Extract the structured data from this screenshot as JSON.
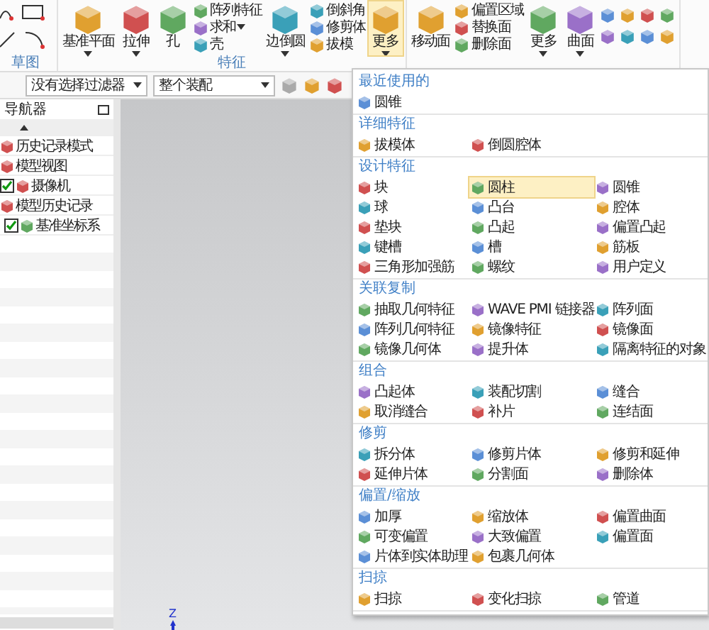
{
  "ribbon": {
    "sketch_group": {
      "label": "草图"
    },
    "feature_group": {
      "label": "特征",
      "tools": [
        {
          "kind": "large",
          "label": "基准平面",
          "dropdown": true,
          "selected": false
        },
        {
          "kind": "large",
          "label": "拉伸",
          "dropdown": true,
          "selected": false
        },
        {
          "kind": "large",
          "label": "孔",
          "dropdown": false,
          "selected": false
        },
        {
          "kind": "stack",
          "items": [
            {
              "label": "阵列特征",
              "dropdown": false
            },
            {
              "label": "求和",
              "dropdown": true
            },
            {
              "label": "壳",
              "dropdown": false
            }
          ]
        },
        {
          "kind": "large",
          "label": "边倒圆",
          "dropdown": true,
          "selected": false
        },
        {
          "kind": "stack",
          "items": [
            {
              "label": "倒斜角",
              "dropdown": false
            },
            {
              "label": "修剪体",
              "dropdown": false
            },
            {
              "label": "拔模",
              "dropdown": false
            }
          ]
        },
        {
          "kind": "large",
          "label": "更多",
          "dropdown": true,
          "selected": true
        }
      ]
    },
    "face_group": {
      "tools": [
        {
          "kind": "large",
          "label": "移动面",
          "dropdown": false,
          "selected": false
        },
        {
          "kind": "stack",
          "items": [
            {
              "label": "偏置区域",
              "dropdown": false
            },
            {
              "label": "替换面",
              "dropdown": false
            },
            {
              "label": "删除面",
              "dropdown": false
            }
          ]
        },
        {
          "kind": "large",
          "label": "更多",
          "dropdown": true,
          "selected": false
        },
        {
          "kind": "large",
          "label": "曲面",
          "dropdown": true,
          "selected": false
        }
      ]
    }
  },
  "toolbar": {
    "filter": "没有选择过滤器",
    "scope": "整个装配"
  },
  "navigator": {
    "title": "导航器",
    "tree": [
      {
        "label": "历史记录模式",
        "kind": "plain"
      },
      {
        "label": "模型视图",
        "kind": "plain"
      },
      {
        "label": "摄像机",
        "kind": "toggle",
        "checked": true
      },
      {
        "label": "模型历史记录",
        "kind": "plain",
        "children": [
          {
            "label": "基准坐标系",
            "kind": "toggle",
            "checked": true
          }
        ]
      }
    ]
  },
  "viewport": {
    "axis_label": "Z"
  },
  "more_menu": {
    "sections": [
      {
        "title": "最近使用的",
        "items": [
          {
            "label": "圆锥",
            "selected": false
          }
        ]
      },
      {
        "title": "详细特征",
        "items": [
          {
            "label": "拔模体",
            "selected": false
          },
          {
            "label": "倒圆腔体",
            "selected": false
          }
        ]
      },
      {
        "title": "设计特征",
        "items": [
          {
            "label": "块",
            "selected": false
          },
          {
            "label": "圆柱",
            "selected": true
          },
          {
            "label": "圆锥",
            "selected": false
          },
          {
            "label": "球",
            "selected": false
          },
          {
            "label": "凸台",
            "selected": false
          },
          {
            "label": "腔体",
            "selected": false
          },
          {
            "label": "垫块",
            "selected": false
          },
          {
            "label": "凸起",
            "selected": false
          },
          {
            "label": "偏置凸起",
            "selected": false
          },
          {
            "label": "键槽",
            "selected": false
          },
          {
            "label": "槽",
            "selected": false
          },
          {
            "label": "筋板",
            "selected": false
          },
          {
            "label": "三角形加强筋",
            "selected": false
          },
          {
            "label": "螺纹",
            "selected": false
          },
          {
            "label": "用户定义",
            "selected": false
          }
        ]
      },
      {
        "title": "关联复制",
        "items": [
          {
            "label": "抽取几何特征",
            "selected": false
          },
          {
            "label": "WAVE PMI 链接器",
            "selected": false
          },
          {
            "label": "阵列面",
            "selected": false
          },
          {
            "label": "阵列几何特征",
            "selected": false
          },
          {
            "label": "镜像特征",
            "selected": false
          },
          {
            "label": "镜像面",
            "selected": false
          },
          {
            "label": "镜像几何体",
            "selected": false
          },
          {
            "label": "提升体",
            "selected": false
          },
          {
            "label": "隔离特征的对象",
            "selected": false
          }
        ]
      },
      {
        "title": "组合",
        "items": [
          {
            "label": "凸起体",
            "selected": false
          },
          {
            "label": "装配切割",
            "selected": false
          },
          {
            "label": "缝合",
            "selected": false
          },
          {
            "label": "取消缝合",
            "selected": false
          },
          {
            "label": "补片",
            "selected": false
          },
          {
            "label": "连结面",
            "selected": false
          }
        ]
      },
      {
        "title": "修剪",
        "items": [
          {
            "label": "拆分体",
            "selected": false
          },
          {
            "label": "修剪片体",
            "selected": false
          },
          {
            "label": "修剪和延伸",
            "selected": false
          },
          {
            "label": "延伸片体",
            "selected": false
          },
          {
            "label": "分割面",
            "selected": false
          },
          {
            "label": "删除体",
            "selected": false
          }
        ]
      },
      {
        "title": "偏置/缩放",
        "items": [
          {
            "label": "加厚",
            "selected": false
          },
          {
            "label": "缩放体",
            "selected": false
          },
          {
            "label": "偏置曲面",
            "selected": false
          },
          {
            "label": "可变偏置",
            "selected": false
          },
          {
            "label": "大致偏置",
            "selected": false
          },
          {
            "label": "偏置面",
            "selected": false
          },
          {
            "label": "片体到实体助理",
            "selected": false
          },
          {
            "label": "包裹几何体",
            "selected": false
          }
        ]
      },
      {
        "title": "扫掠",
        "items": [
          {
            "label": "扫掠",
            "selected": false
          },
          {
            "label": "变化扫掠",
            "selected": false
          },
          {
            "label": "管道",
            "selected": false
          }
        ]
      }
    ]
  }
}
